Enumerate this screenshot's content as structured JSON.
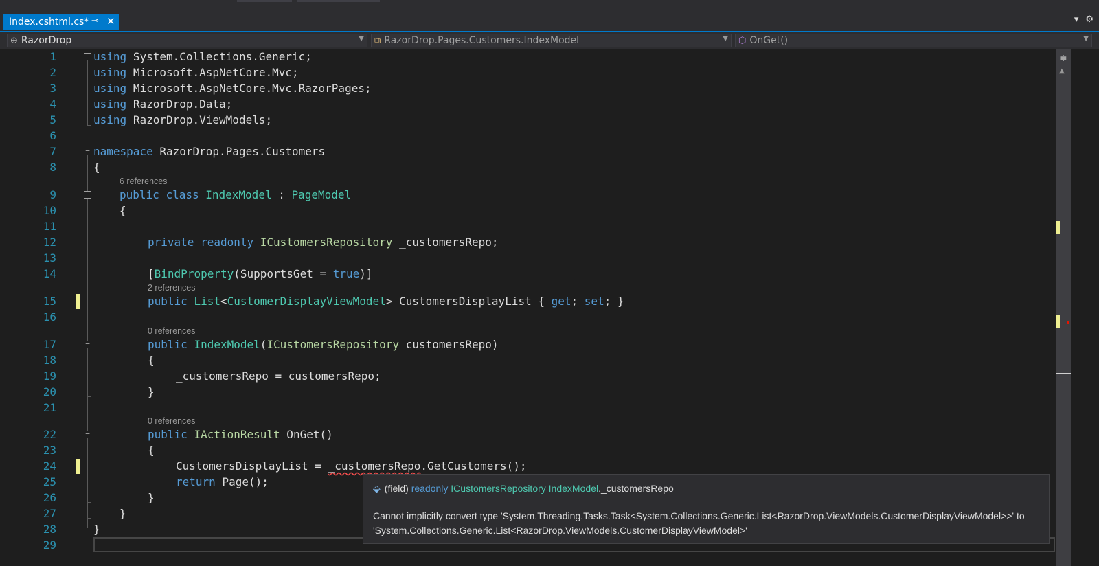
{
  "tab": {
    "title": "Index.cshtml.cs*",
    "pin_icon": "pin-icon",
    "close_icon": "close-icon"
  },
  "navbar": {
    "project": "RazorDrop",
    "type": "RazorDrop.Pages.Customers.IndexModel",
    "member": "OnGet()"
  },
  "code": {
    "l1_rest": "System.Collections.Generic;",
    "l2_rest": "Microsoft.AspNetCore.Mvc;",
    "l3_rest": "Microsoft.AspNetCore.Mvc.RazorPages;",
    "l4_rest": "RazorDrop.Data;",
    "l5_rest": "RazorDrop.ViewModels;",
    "kw_using": "using",
    "kw_namespace": "namespace",
    "ns_name": " RazorDrop.Pages.Customers",
    "open_brace": "{",
    "close_brace": "}",
    "l9_public": "public",
    "l9_class": "class",
    "l9_name": "IndexModel",
    "l9_colon": " : ",
    "l9_base": "PageModel",
    "l12_private": "private",
    "l12_readonly": "readonly",
    "l12_type": "ICustomersRepository",
    "l12_rest": " _customersRepo;",
    "l14_open": "[",
    "l14_attr": "BindProperty",
    "l14_mid": "(SupportsGet = ",
    "l14_true": "true",
    "l14_close": ")]",
    "l15_public": "public",
    "l15_list": "List",
    "l15_lt": "<",
    "l15_vm": "CustomerDisplayViewModel",
    "l15_gt": "> CustomersDisplayList { ",
    "l15_get": "get",
    "l15_semi": "; ",
    "l15_set": "set",
    "l15_end": "; }",
    "l17_public": "public",
    "l17_name": "IndexModel",
    "l17_open": "(",
    "l17_type": "ICustomersRepository",
    "l17_rest": " customersRepo)",
    "l19": "_customersRepo = customersRepo;",
    "l22_public": "public",
    "l22_type": "IActionResult",
    "l22_rest": " OnGet()",
    "l24_a": "CustomersDisplayList = ",
    "l24_b": "_customersRepo",
    "l24_c": ".GetCustomers();",
    "l25_return": "return",
    "l25_rest": " Page();"
  },
  "refs": {
    "r9": "6 references",
    "r15": "2 references",
    "r17": "0 references",
    "r22": "0 references"
  },
  "line_numbers": [
    "1",
    "2",
    "3",
    "4",
    "5",
    "6",
    "7",
    "8",
    "9",
    "10",
    "11",
    "12",
    "13",
    "14",
    "15",
    "16",
    "17",
    "18",
    "19",
    "20",
    "21",
    "22",
    "23",
    "24",
    "25",
    "26",
    "27",
    "28",
    "29"
  ],
  "tooltip": {
    "icon": "field-icon",
    "kind": "(field) ",
    "readonly": "readonly ",
    "type": "ICustomersRepository ",
    "owner": "IndexModel",
    "member": "._customersRepo",
    "message": "Cannot implicitly convert type 'System.Threading.Tasks.Task<System.Collections.Generic.List<RazorDrop.ViewModels.CustomerDisplayViewModel>>' to 'System.Collections.Generic.List<RazorDrop.ViewModels.CustomerDisplayViewModel>'"
  },
  "colors": {
    "accent": "#007acc",
    "keyword": "#569cd6",
    "type": "#4ec9b0",
    "interface": "#b8d7a3",
    "error": "#f14c4c",
    "change": "#efef91"
  }
}
